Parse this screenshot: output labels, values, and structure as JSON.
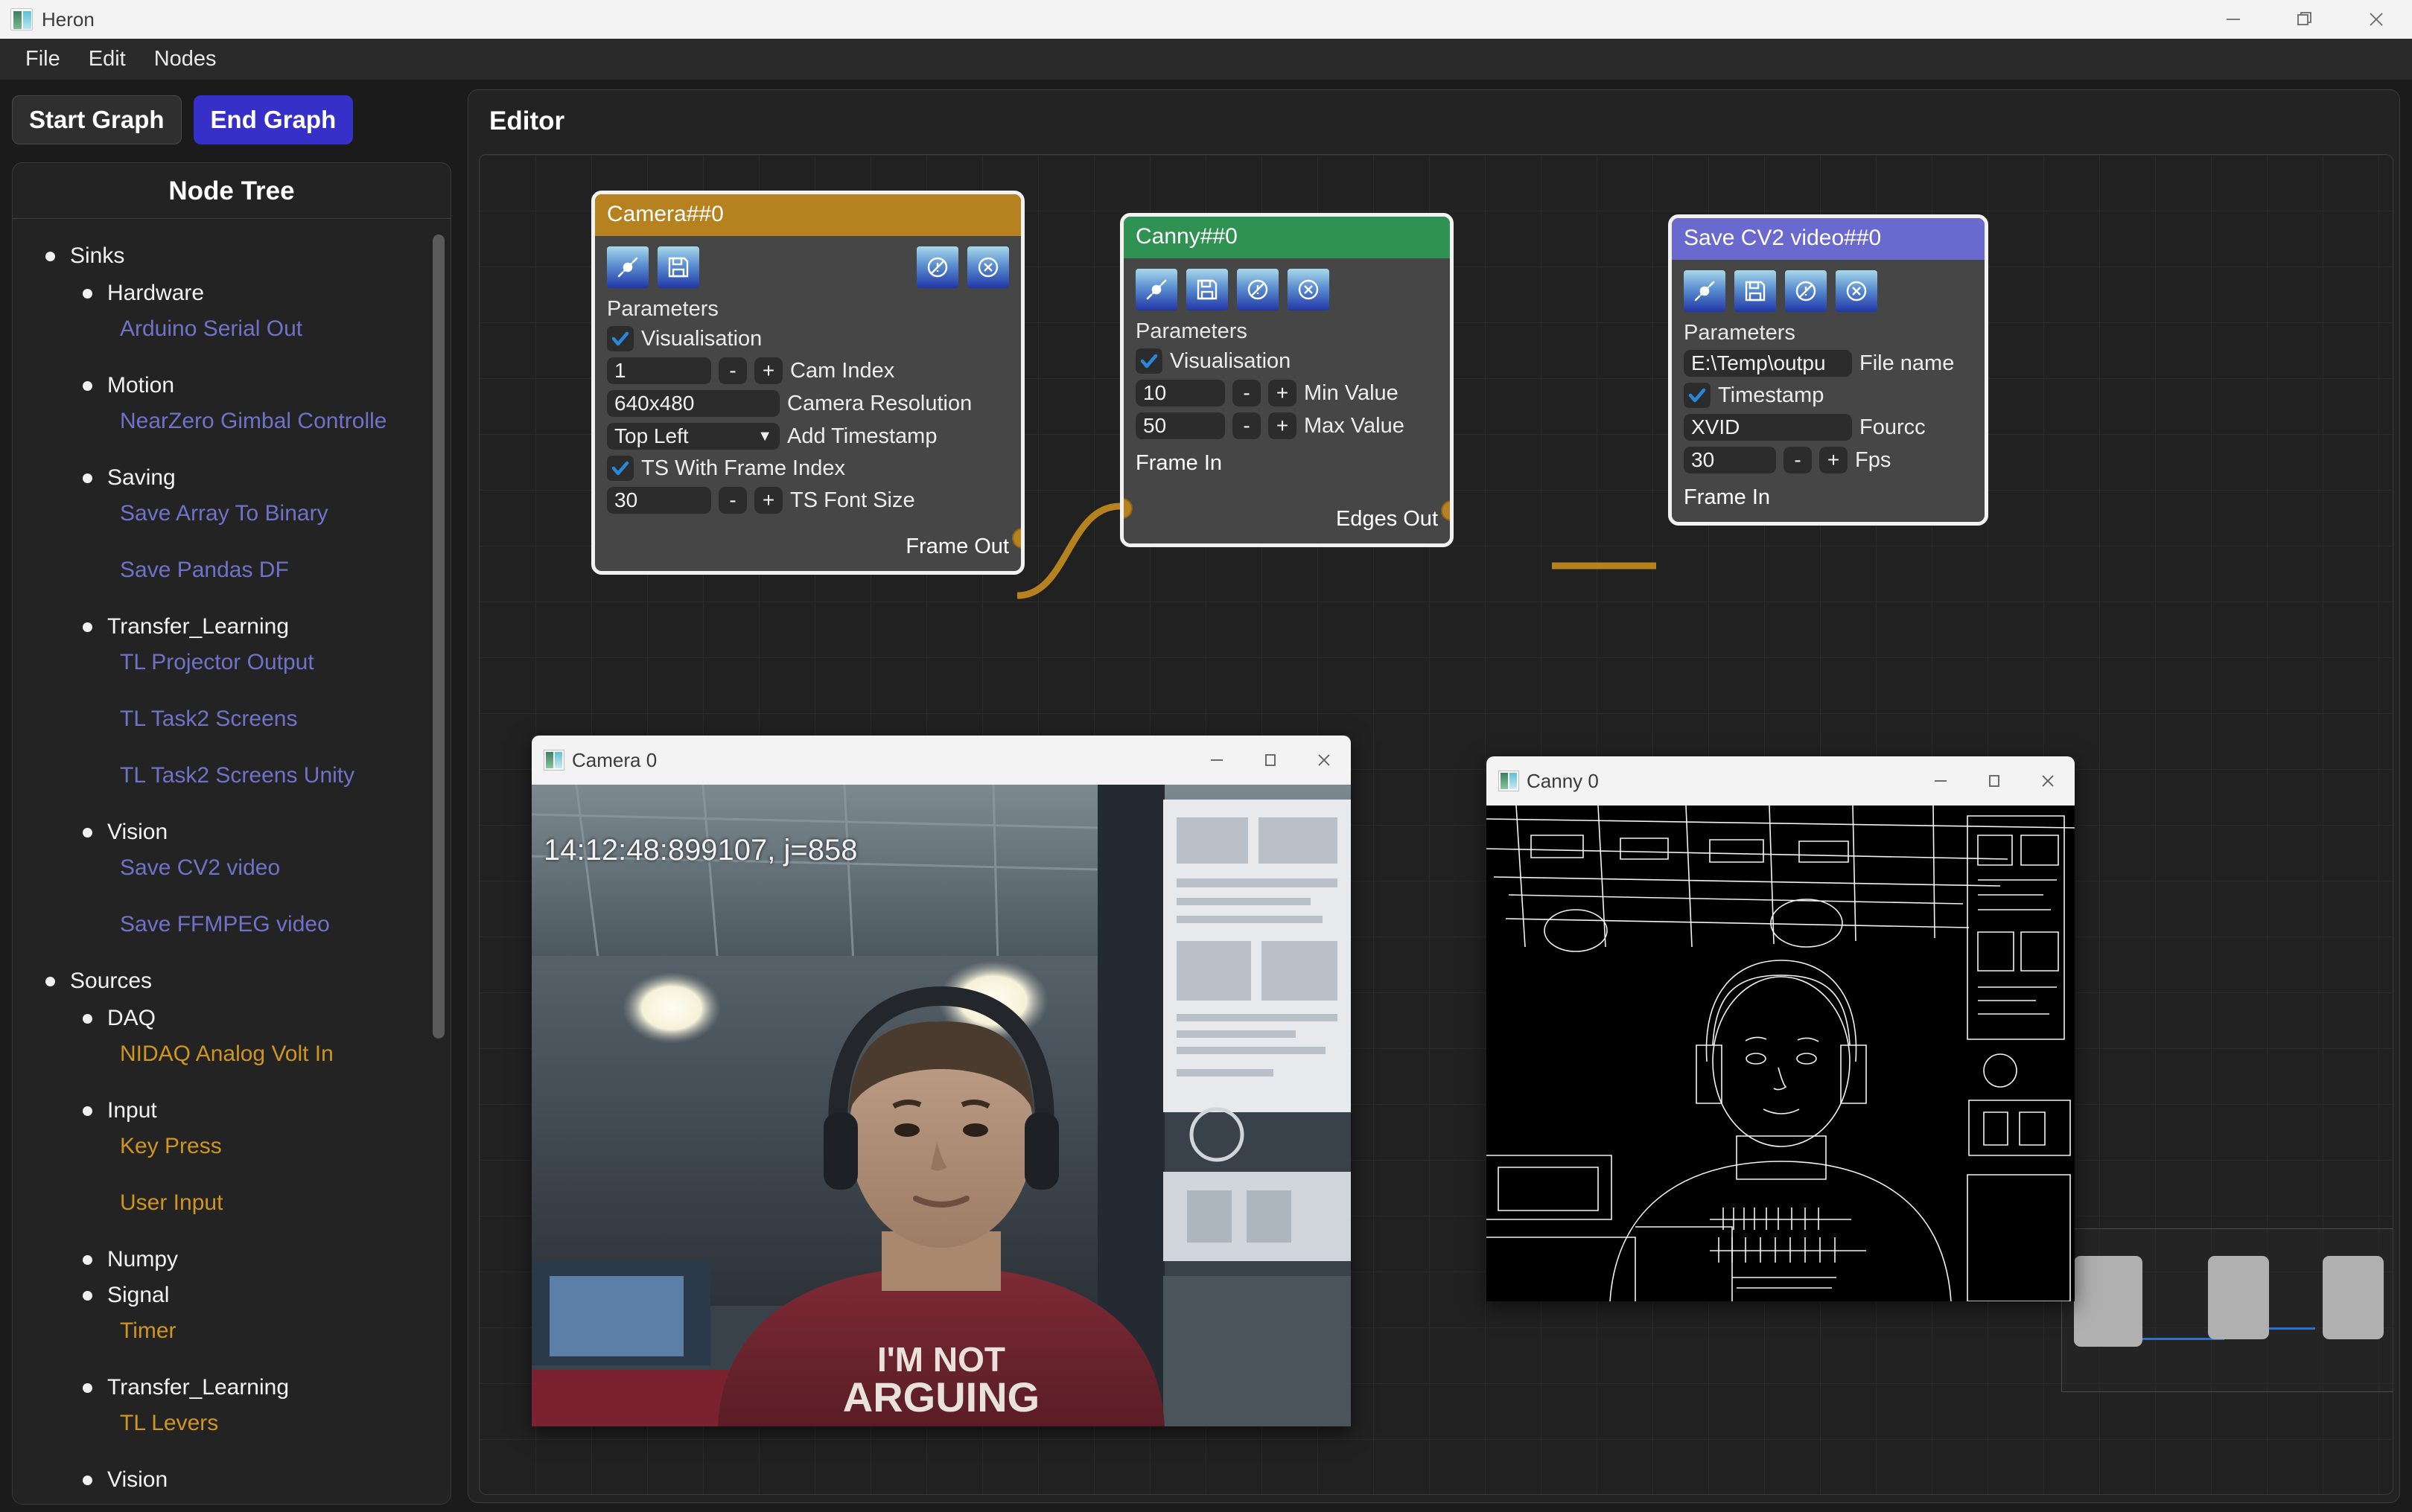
{
  "window": {
    "title": "Heron",
    "controls": {
      "minimize": "minimize-icon",
      "restore": "restore-icon",
      "close": "close-icon"
    }
  },
  "menubar": {
    "items": [
      "File",
      "Edit",
      "Nodes"
    ]
  },
  "toolbar": {
    "start_graph": "Start Graph",
    "end_graph": "End Graph",
    "accent_color": "#3730c8"
  },
  "node_tree": {
    "title": "Node Tree",
    "groups": [
      {
        "label": "Sinks",
        "children": [
          {
            "label": "Hardware",
            "leaves": [
              "Arduino Serial Out"
            ]
          },
          {
            "label": "Motion",
            "leaves": [
              "NearZero Gimbal Controlle"
            ]
          },
          {
            "label": "Saving",
            "leaves": [
              "Save Array To Binary",
              "Save Pandas DF"
            ]
          },
          {
            "label": "Transfer_Learning",
            "leaves": [
              "TL Projector Output",
              "TL Task2 Screens",
              "TL Task2 Screens Unity"
            ]
          },
          {
            "label": "Vision",
            "leaves": [
              "Save CV2 video",
              "Save FFMPEG video"
            ]
          }
        ]
      },
      {
        "label": "Sources",
        "children": [
          {
            "label": "DAQ",
            "leaves": [
              "NIDAQ Analog Volt In"
            ]
          },
          {
            "label": "Input",
            "leaves": [
              "Key Press",
              "User Input"
            ]
          },
          {
            "label": "Numpy",
            "leaves": []
          },
          {
            "label": "Signal",
            "leaves": [
              "Timer"
            ]
          },
          {
            "label": "Transfer_Learning",
            "leaves": [
              "TL Levers"
            ]
          },
          {
            "label": "Vision",
            "leaves": []
          }
        ]
      }
    ],
    "sink_leaf_color": "#6f72c9",
    "source_leaf_color": "#cf9520"
  },
  "editor": {
    "title": "Editor",
    "link_color": "#b5821f",
    "nodes": [
      {
        "id": "camera",
        "title": "Camera##0",
        "header_color": "#b5821f",
        "params_label": "Parameters",
        "icons": [
          "link-icon",
          "save-icon",
          "no-entry-icon",
          "close-circle-icon"
        ],
        "rows": [
          {
            "kind": "checkbox",
            "checked": true,
            "label": "Visualisation"
          },
          {
            "kind": "stepper",
            "value": "1",
            "minus": "-",
            "plus": "+",
            "label": "Cam Index"
          },
          {
            "kind": "text",
            "value": "640x480",
            "label": "Camera Resolution"
          },
          {
            "kind": "dropdown",
            "value": "Top Left",
            "label": "Add Timestamp"
          },
          {
            "kind": "checkbox",
            "checked": true,
            "label": "TS With Frame Index"
          },
          {
            "kind": "stepper",
            "value": "30",
            "minus": "-",
            "plus": "+",
            "label": "TS Font Size"
          }
        ],
        "output_port": "Frame Out"
      },
      {
        "id": "canny",
        "title": "Canny##0",
        "header_color": "#2f9152",
        "params_label": "Parameters",
        "icons": [
          "link-icon",
          "save-icon",
          "no-entry-icon",
          "close-circle-icon"
        ],
        "rows": [
          {
            "kind": "checkbox",
            "checked": true,
            "label": "Visualisation"
          },
          {
            "kind": "stepper",
            "value": "10",
            "minus": "-",
            "plus": "+",
            "label": "Min Value"
          },
          {
            "kind": "stepper",
            "value": "50",
            "minus": "-",
            "plus": "+",
            "label": "Max Value"
          }
        ],
        "input_port": "Frame In",
        "output_port": "Edges Out"
      },
      {
        "id": "savecv2",
        "title": "Save CV2 video##0",
        "header_color": "#6a6ace",
        "params_label": "Parameters",
        "icons": [
          "link-icon",
          "save-icon",
          "no-entry-icon",
          "close-circle-icon"
        ],
        "rows": [
          {
            "kind": "text",
            "value": "E:\\Temp\\outpu",
            "label": "File name"
          },
          {
            "kind": "checkbox",
            "checked": true,
            "label": "Timestamp"
          },
          {
            "kind": "text",
            "value": "XVID",
            "label": "Fourcc"
          },
          {
            "kind": "stepper",
            "value": "30",
            "minus": "-",
            "plus": "+",
            "label": "Fps"
          }
        ],
        "input_port": "Frame In"
      }
    ]
  },
  "video_windows": [
    {
      "id": "camera0",
      "title": "Camera 0",
      "overlay_text": "14:12:48:899107, j=858",
      "controls": {
        "minimize": "minimize-icon",
        "maximize": "maximize-icon",
        "close": "close-icon"
      }
    },
    {
      "id": "canny0",
      "title": "Canny 0",
      "overlay_text": "",
      "controls": {
        "minimize": "minimize-icon",
        "maximize": "maximize-icon",
        "close": "close-icon"
      }
    }
  ],
  "minimap": {
    "node_count": 3,
    "link_color": "#2f6fd0"
  }
}
